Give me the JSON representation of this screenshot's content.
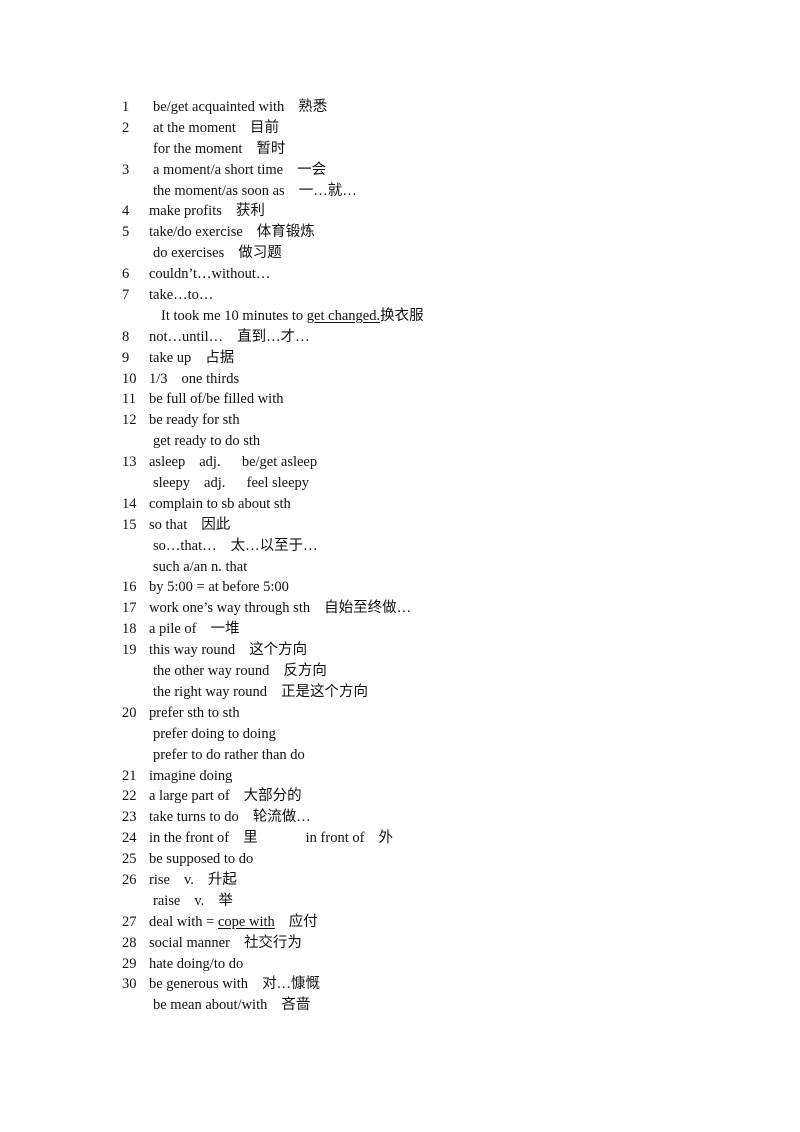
{
  "document": {
    "lines": [
      {
        "num": "1",
        "segments": [
          {
            "text": "be/get acquainted with"
          },
          {
            "gap": true
          },
          {
            "text": "熟悉"
          }
        ]
      },
      {
        "num": "2",
        "segments": [
          {
            "text": "at the moment"
          },
          {
            "gap": true
          },
          {
            "text": "目前"
          }
        ]
      },
      {
        "num": "",
        "segments": [
          {
            "text": "for the moment"
          },
          {
            "gap": true
          },
          {
            "text": "暂时"
          }
        ]
      },
      {
        "num": "3",
        "segments": [
          {
            "text": "a moment/a short time"
          },
          {
            "gap": true
          },
          {
            "text": "一会"
          }
        ]
      },
      {
        "num": "",
        "segments": [
          {
            "text": "the moment/as soon as"
          },
          {
            "gap": true
          },
          {
            "text": "一…就…"
          }
        ]
      },
      {
        "num": "4",
        "segments": [
          {
            "text": "make profits"
          },
          {
            "gap": true
          },
          {
            "text": "获利"
          }
        ]
      },
      {
        "num": "5",
        "segments": [
          {
            "text": "take/do exercise"
          },
          {
            "gap": true
          },
          {
            "text": "体育锻炼"
          }
        ]
      },
      {
        "num": "",
        "segments": [
          {
            "text": "do exercises"
          },
          {
            "gap": true
          },
          {
            "text": "做习题"
          }
        ]
      },
      {
        "num": "6",
        "segments": [
          {
            "text": "couldn’t…without…"
          }
        ]
      },
      {
        "num": "7",
        "segments": [
          {
            "text": "take…to…"
          }
        ]
      },
      {
        "num": "",
        "sub": true,
        "segments": [
          {
            "text": "It took me 10 minutes to "
          },
          {
            "text": "get changed.",
            "underline": true
          },
          {
            "text": "换衣服"
          }
        ]
      },
      {
        "num": "8",
        "segments": [
          {
            "text": "not…until…"
          },
          {
            "gap": true
          },
          {
            "text": "直到…才…"
          }
        ]
      },
      {
        "num": "9",
        "segments": [
          {
            "text": "take up"
          },
          {
            "gap": true
          },
          {
            "text": "占据"
          }
        ]
      },
      {
        "num": "10",
        "segments": [
          {
            "text": "1/3"
          },
          {
            "gap": true
          },
          {
            "text": "one thirds"
          }
        ]
      },
      {
        "num": "11",
        "segments": [
          {
            "text": "be full of/be filled with"
          }
        ]
      },
      {
        "num": "12",
        "segments": [
          {
            "text": "be ready for sth"
          }
        ]
      },
      {
        "num": "",
        "segments": [
          {
            "text": "get ready to do sth"
          }
        ]
      },
      {
        "num": "13",
        "segments": [
          {
            "text": "asleep"
          },
          {
            "gap": true
          },
          {
            "text": "adj."
          },
          {
            "gap": true
          },
          {
            "text": "  be/get asleep"
          }
        ]
      },
      {
        "num": "",
        "segments": [
          {
            "text": "sleepy"
          },
          {
            "gap": true
          },
          {
            "text": "adj."
          },
          {
            "gap": true
          },
          {
            "text": "  feel sleepy"
          }
        ]
      },
      {
        "num": "14",
        "segments": [
          {
            "text": "complain to sb about sth"
          }
        ]
      },
      {
        "num": "15",
        "segments": [
          {
            "text": "so that"
          },
          {
            "gap": true
          },
          {
            "text": "因此"
          }
        ]
      },
      {
        "num": "",
        "segments": [
          {
            "text": "so…that…"
          },
          {
            "gap": true
          },
          {
            "text": "太…以至于…"
          }
        ]
      },
      {
        "num": "",
        "segments": [
          {
            "text": "such a/an n. that"
          }
        ]
      },
      {
        "num": "16",
        "segments": [
          {
            "text": "by 5:00 = at before 5:00"
          }
        ]
      },
      {
        "num": "17",
        "segments": [
          {
            "text": "work one’s way through sth"
          },
          {
            "gap": true
          },
          {
            "text": "自始至终做…"
          }
        ]
      },
      {
        "num": "18",
        "segments": [
          {
            "text": "a pile of"
          },
          {
            "gap": true
          },
          {
            "text": "一堆"
          }
        ]
      },
      {
        "num": "19",
        "segments": [
          {
            "text": "this way round"
          },
          {
            "gap": true
          },
          {
            "text": "这个方向"
          }
        ]
      },
      {
        "num": "",
        "segments": [
          {
            "text": "the other way round"
          },
          {
            "gap": true
          },
          {
            "text": "反方向"
          }
        ]
      },
      {
        "num": "",
        "segments": [
          {
            "text": "the right way round"
          },
          {
            "gap": true
          },
          {
            "text": "正是这个方向"
          }
        ]
      },
      {
        "num": "20",
        "segments": [
          {
            "text": "prefer sth to sth"
          }
        ]
      },
      {
        "num": "",
        "segments": [
          {
            "text": "prefer doing to doing"
          }
        ]
      },
      {
        "num": "",
        "segments": [
          {
            "text": "prefer to do rather than do"
          }
        ]
      },
      {
        "num": "21",
        "segments": [
          {
            "text": "imagine doing"
          }
        ]
      },
      {
        "num": "22",
        "segments": [
          {
            "text": "a large part of"
          },
          {
            "gap": true
          },
          {
            "text": "大部分的"
          }
        ]
      },
      {
        "num": "23",
        "segments": [
          {
            "text": "take turns to do"
          },
          {
            "gap": true
          },
          {
            "text": "轮流做…"
          }
        ]
      },
      {
        "num": "24",
        "segments": [
          {
            "text": "in the front of"
          },
          {
            "gap": true
          },
          {
            "text": "里"
          },
          {
            "gapwide": true
          },
          {
            "text": "in front of"
          },
          {
            "gap": true
          },
          {
            "text": "外"
          }
        ]
      },
      {
        "num": "25",
        "segments": [
          {
            "text": "be supposed to do"
          }
        ]
      },
      {
        "num": "26",
        "segments": [
          {
            "text": "rise"
          },
          {
            "gap": true
          },
          {
            "text": "v."
          },
          {
            "gap": true
          },
          {
            "text": "升起"
          }
        ]
      },
      {
        "num": "",
        "segments": [
          {
            "text": "raise"
          },
          {
            "gap": true
          },
          {
            "text": "v."
          },
          {
            "gap": true
          },
          {
            "text": "举"
          }
        ]
      },
      {
        "num": "27",
        "segments": [
          {
            "text": "deal with = "
          },
          {
            "text": "cope with",
            "underline": true
          },
          {
            "gap": true
          },
          {
            "text": "应付"
          }
        ]
      },
      {
        "num": "28",
        "segments": [
          {
            "text": "social manner"
          },
          {
            "gap": true
          },
          {
            "text": "社交行为"
          }
        ]
      },
      {
        "num": "29",
        "segments": [
          {
            "text": "hate doing/to do"
          }
        ]
      },
      {
        "num": "30",
        "segments": [
          {
            "text": "be generous with"
          },
          {
            "gap": true
          },
          {
            "text": "对…慷慨"
          }
        ]
      },
      {
        "num": "",
        "segments": [
          {
            "text": "be mean about/with"
          },
          {
            "gap": true
          },
          {
            "text": "吝啬"
          }
        ]
      }
    ]
  }
}
